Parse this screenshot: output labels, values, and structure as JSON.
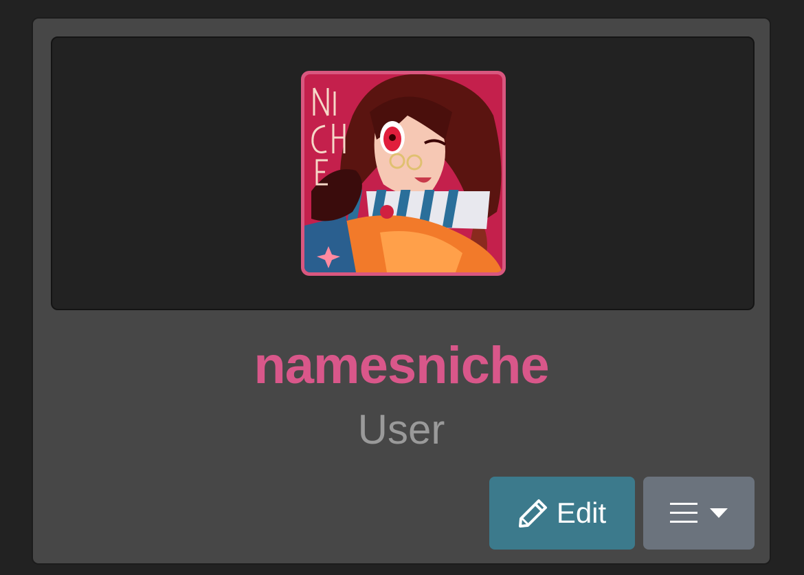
{
  "profile": {
    "username": "namesniche",
    "role": "User",
    "avatar_icon": "avatar-image",
    "avatar_art_text": "NICHE"
  },
  "actions": {
    "edit_label": "Edit",
    "edit_icon": "pencil-icon",
    "menu_icon": "hamburger-menu-icon",
    "menu_caret_icon": "caret-down-icon"
  },
  "colors": {
    "page_background": "#222222",
    "card_background": "#474747",
    "banner_background": "#222222",
    "username": "#d9578a",
    "role": "#9a9a9a",
    "edit_button": "#3c7a8c",
    "menu_button": "#6b737d",
    "avatar_border": "#d9577f"
  }
}
